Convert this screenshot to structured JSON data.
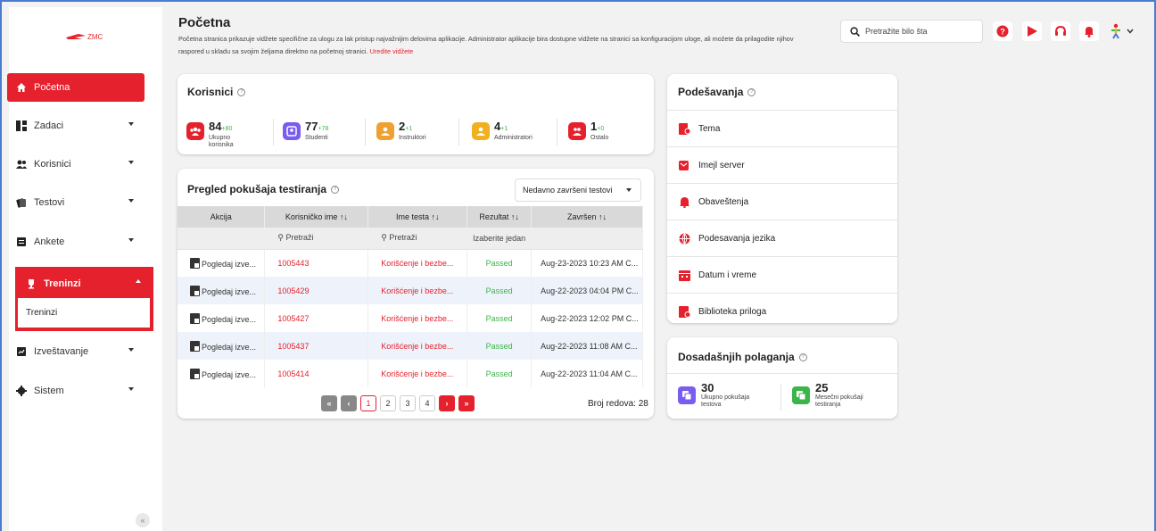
{
  "brand": {
    "logo_text": "ZMC",
    "accent": "#e5212d"
  },
  "sidebar": {
    "items": [
      {
        "label": "Početna",
        "icon": "home-icon"
      },
      {
        "label": "Zadaci",
        "icon": "tasks-icon"
      },
      {
        "label": "Korisnici",
        "icon": "users-icon"
      },
      {
        "label": "Testovi",
        "icon": "tests-icon"
      },
      {
        "label": "Ankete",
        "icon": "survey-icon"
      },
      {
        "label": "Treninzi",
        "icon": "trophy-icon"
      },
      {
        "label": "Izveštavanje",
        "icon": "report-icon"
      },
      {
        "label": "Sistem",
        "icon": "gear-icon"
      }
    ],
    "sub_item": "Treninzi",
    "collapse": "«"
  },
  "header": {
    "title": "Početna",
    "description": "Početna stranica prikazuje vidžete specifične za ulogu za lak pristup najvažnijim delovima aplikacije. Administrator aplikacije bira dostupne vidžete na stranici sa konfiguracijom uloge, ali možete da prilagodite njihov raspored u skladu sa svojim željama direktno na početnoj stranici.",
    "edit_link": "Uredite vidžete",
    "search_placeholder": "Pretražite bilo šta"
  },
  "users_card": {
    "title": "Korisnici",
    "stats": [
      {
        "value": "84",
        "delta": "+80",
        "label": "Ukupno korisnika",
        "color": "#e5212d"
      },
      {
        "value": "77",
        "delta": "+78",
        "label": "Studenti",
        "color": "#7a5cf0"
      },
      {
        "value": "2",
        "delta": "+1",
        "label": "Instruktori",
        "color": "#f0a030"
      },
      {
        "value": "4",
        "delta": "+1",
        "label": "Administratori",
        "color": "#f0b020"
      },
      {
        "value": "1",
        "delta": "+0",
        "label": "Ostalo",
        "color": "#e5212d"
      }
    ]
  },
  "attempts_card": {
    "title": "Pregled pokušaja testiranja",
    "dropdown": "Nedavno završeni testovi",
    "columns": [
      "Akcija",
      "Korisničko ime ↑↓",
      "Ime testa ↑↓",
      "Rezultat ↑↓",
      "Završen ↑↓"
    ],
    "filters": {
      "search": "Pretraži",
      "select": "Izaberite jedan"
    },
    "rows": [
      {
        "action": "Pogledaj izve...",
        "user": "1005443",
        "test": "Korišćenje i bezbe...",
        "result": "Passed",
        "done": "Aug-23-2023 10:23 AM C..."
      },
      {
        "action": "Pogledaj izve...",
        "user": "1005429",
        "test": "Korišćenje i bezbe...",
        "result": "Passed",
        "done": "Aug-22-2023 04:04 PM C..."
      },
      {
        "action": "Pogledaj izve...",
        "user": "1005427",
        "test": "Korišćenje i bezbe...",
        "result": "Passed",
        "done": "Aug-22-2023 12:02 PM C..."
      },
      {
        "action": "Pogledaj izve...",
        "user": "1005437",
        "test": "Korišćenje i bezbe...",
        "result": "Passed",
        "done": "Aug-22-2023 11:08 AM C..."
      },
      {
        "action": "Pogledaj izve...",
        "user": "1005414",
        "test": "Korišćenje i bezbe...",
        "result": "Passed",
        "done": "Aug-22-2023 11:04 AM C..."
      }
    ],
    "pagination": {
      "first": "«",
      "prev": "‹",
      "pages": [
        "1",
        "2",
        "3",
        "4"
      ],
      "next": "›",
      "last": "»"
    },
    "rows_count": "Broj redova: 28"
  },
  "settings_card": {
    "title": "Podešavanja",
    "items": [
      {
        "label": "Tema",
        "icon": "theme-icon"
      },
      {
        "label": "Imejl server",
        "icon": "mail-server-icon"
      },
      {
        "label": "Obaveštenja",
        "icon": "bell-icon"
      },
      {
        "label": "Podesavanja jezika",
        "icon": "globe-icon"
      },
      {
        "label": "Datum i vreme",
        "icon": "calendar-icon"
      },
      {
        "label": "Biblioteka priloga",
        "icon": "library-icon"
      }
    ]
  },
  "exams_card": {
    "title": "Dosadašnjih polaganja",
    "stats": [
      {
        "value": "30",
        "label": "Ukupno pokušaja testova",
        "color": "#7a5cf0"
      },
      {
        "value": "25",
        "label": "Mesečni pokušaji testiranja",
        "color": "#3bb54a"
      }
    ]
  }
}
